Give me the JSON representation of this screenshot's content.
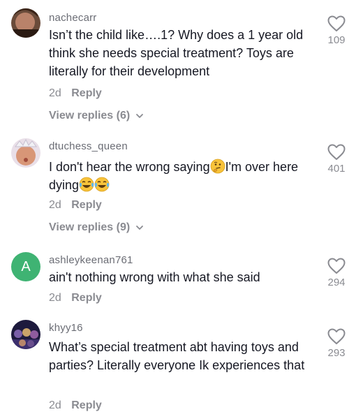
{
  "comments": [
    {
      "username": "nachecarr",
      "text": "Isn’t the child like….1? Why does a 1 year old think she needs special treatment? Toys are literally for their development",
      "age": "2d",
      "reply_label": "Reply",
      "view_replies": "View replies (6)",
      "likes": "109",
      "icon": "heart-outline-icon"
    },
    {
      "username": "dtuchess_queen",
      "text_part1": "I don't hear the wrong saying",
      "text_part2": "I'm over here dying",
      "emojis": [
        "thinking-face-emoji",
        "tears-of-joy-emoji",
        "tears-of-joy-emoji"
      ],
      "age": "2d",
      "reply_label": "Reply",
      "view_replies": "View replies (9)",
      "likes": "401",
      "icon": "heart-outline-icon"
    },
    {
      "username": "ashleykeenan761",
      "avatar_letter": "A",
      "avatar_color": "#3fb373",
      "text": "ain't nothing wrong with what she said",
      "age": "2d",
      "reply_label": "Reply",
      "likes": "294",
      "icon": "heart-outline-icon"
    },
    {
      "username": "khyy16",
      "text": "What’s special treatment abt having toys and parties? Literally everyone Ik experiences that",
      "age": "2d",
      "reply_label": "Reply",
      "likes": "293",
      "icon": "heart-outline-icon"
    }
  ],
  "colors": {
    "text": "#161823",
    "muted": "#8a8b91",
    "username": "#6b6d75"
  }
}
